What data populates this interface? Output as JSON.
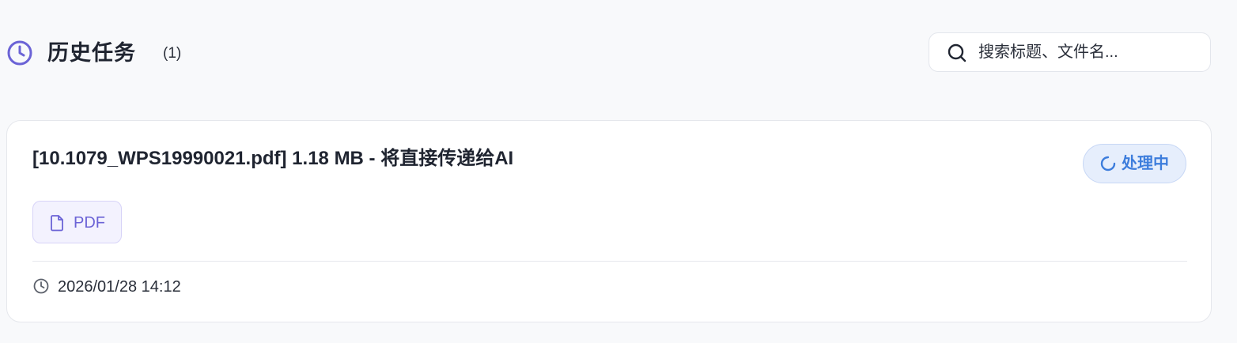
{
  "header": {
    "title": "历史任务",
    "count": "(1)",
    "icon": "clock-icon",
    "accent_color": "#6b63d6"
  },
  "search": {
    "placeholder": "搜索标题、文件名...",
    "value": "",
    "icon": "search-icon"
  },
  "tasks": [
    {
      "title": "[10.1079_WPS19990021.pdf] 1.18 MB - 将直接传递给AI",
      "status": "处理中",
      "status_icon": "spinner-icon",
      "status_color": "#3d7ddc",
      "file_type": "PDF",
      "file_icon": "file-icon",
      "timestamp": "2026/01/28 14:12",
      "time_icon": "clock-icon"
    }
  ]
}
